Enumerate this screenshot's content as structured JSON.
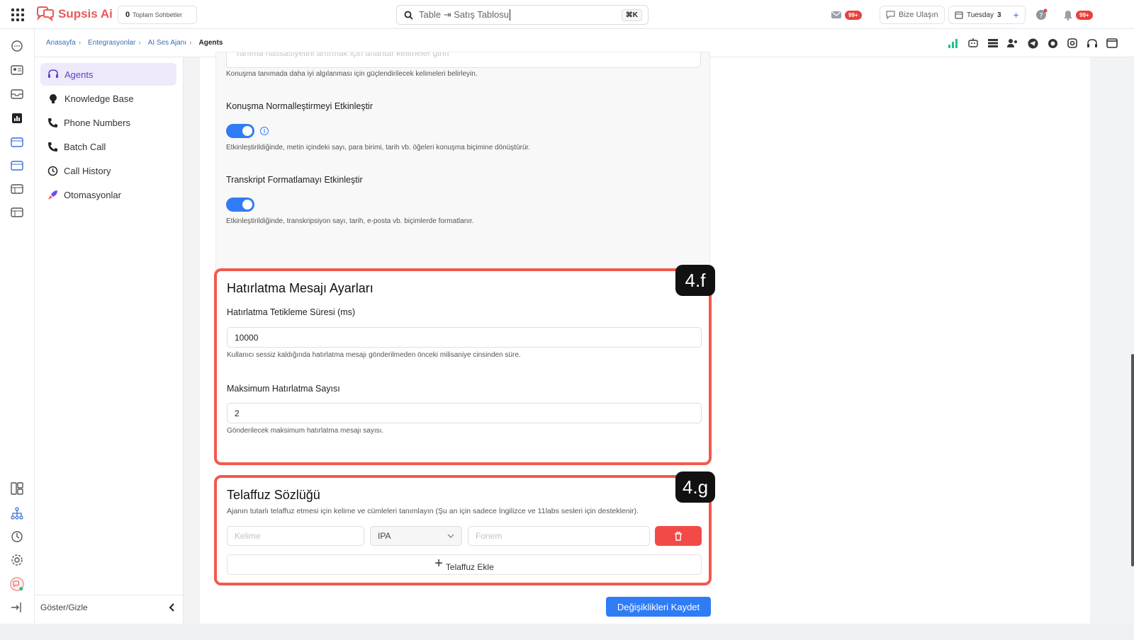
{
  "app": {
    "name": "Supsis Ai"
  },
  "topbar": {
    "total_chats_count": "0",
    "total_chats_label": "Toplam Sohbetler",
    "search_value": "Table ⇥ Satış Tablosu",
    "search_shortcut": "⌘K",
    "mail_badge": "99+",
    "contact_label": "Bize Ulaşın",
    "calendar_day": "Tuesday",
    "calendar_date": "3",
    "notif_badge": "99+"
  },
  "breadcrumb": {
    "items": [
      "Anasayfa",
      "Entegrasyonlar",
      "AI Ses Ajanı"
    ],
    "current": "Agents",
    "separator": "›"
  },
  "sidebar": {
    "items": [
      {
        "label": "Agents"
      },
      {
        "label": "Knowledge Base"
      },
      {
        "label": "Phone Numbers"
      },
      {
        "label": "Batch Call"
      },
      {
        "label": "Call History"
      },
      {
        "label": "Otomasyonlar"
      }
    ],
    "footer_label": "Göster/Gizle"
  },
  "settings_top": {
    "placeholder": "Tanıma hassasiyetini artırmak için anahtar kelimeler girin",
    "keywords_help": "Konuşma tanımada daha iyi algılanması için güçlendirilecek kelimeleri belirleyin.",
    "speech_norm_label": "Konuşma Normalleştirmeyi Etkinleştir",
    "speech_norm_help": "Etkinleştirildiğinde, metin içindeki sayı, para birimi, tarih vb. öğeleri konuşma biçimine dönüştürür.",
    "speech_norm_on": true,
    "transcript_label": "Transkript Formatlamayı Etkinleştir",
    "transcript_help": "Etkinleştirildiğinde, transkripsiyon sayı, tarih, e-posta vb. biçimlerde formatlanır.",
    "transcript_on": true
  },
  "reminder": {
    "tag": "4.f",
    "title": "Hatırlatma Mesajı Ayarları",
    "trigger_label": "Hatırlatma Tetikleme Süresi (ms)",
    "trigger_value": "10000",
    "trigger_help": "Kullanıcı sessiz kaldığında hatırlatma mesajı gönderilmeden önceki milisaniye cinsinden süre.",
    "max_label": "Maksimum Hatırlatma Sayısı",
    "max_value": "2",
    "max_help": "Gönderilecek maksimum hatırlatma mesajı sayısı."
  },
  "pronunciation": {
    "tag": "4.g",
    "title": "Telaffuz Sözlüğü",
    "description": "Ajanın tutarlı telaffuz etmesi için kelime ve cümleleri tanımlayın (Şu an için sadece İngilizce ve 11labs sesleri için desteklenir).",
    "word_placeholder": "Kelime",
    "alphabet_value": "IPA",
    "phoneme_placeholder": "Fonem",
    "add_label": "Telaffuz Ekle"
  },
  "save_label": "Değişiklikleri Kaydet",
  "colors": {
    "accent": "#2f7cf6",
    "brand": "#e85a5a",
    "highlight": "#f15a4f",
    "danger": "#f24b47",
    "active_bg": "#efeafb"
  }
}
